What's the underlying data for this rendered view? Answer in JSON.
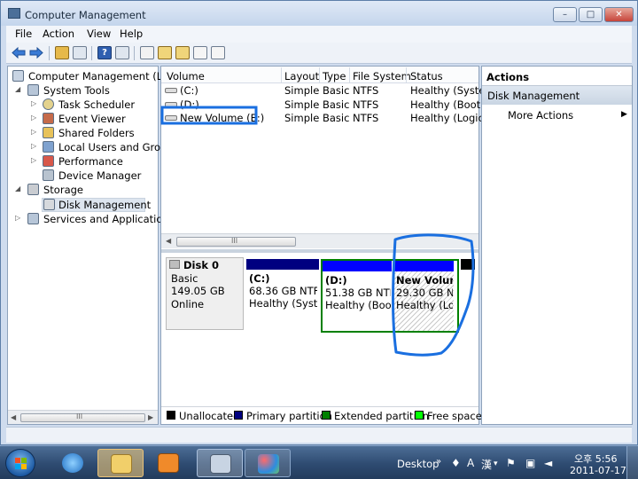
{
  "window": {
    "title": "Computer Management",
    "menu": [
      "File",
      "Action",
      "View",
      "Help"
    ]
  },
  "tree": {
    "root": "Computer Management (Local",
    "system_tools": "System Tools",
    "task_scheduler": "Task Scheduler",
    "event_viewer": "Event Viewer",
    "shared_folders": "Shared Folders",
    "local_users": "Local Users and Groups",
    "performance": "Performance",
    "device_manager": "Device Manager",
    "storage": "Storage",
    "disk_management": "Disk Management",
    "services": "Services and Applications",
    "scroll_grip": "III"
  },
  "volumes": {
    "columns": [
      "Volume",
      "Layout",
      "Type",
      "File System",
      "Status"
    ],
    "rows": [
      {
        "volume": "(C:)",
        "layout": "Simple",
        "type": "Basic",
        "fs": "NTFS",
        "status": "Healthy (System"
      },
      {
        "volume": "(D:)",
        "layout": "Simple",
        "type": "Basic",
        "fs": "NTFS",
        "status": "Healthy (Boot, P"
      },
      {
        "volume": "New Volume (E:)",
        "layout": "Simple",
        "type": "Basic",
        "fs": "NTFS",
        "status": "Healthy (Logica"
      }
    ],
    "scroll_grip": "III"
  },
  "disk": {
    "name": "Disk 0",
    "type": "Basic",
    "size": "149.05 GB",
    "state": "Online",
    "partitions": [
      {
        "name": "(C:)",
        "size": "68.36 GB NTFS",
        "status": "Healthy (Syste"
      },
      {
        "name": "(D:)",
        "size": "51.38 GB NTF",
        "status": "Healthy (Boo"
      },
      {
        "name": "New Volum",
        "size": "29.30 GB NT",
        "status": "Healthy (Log"
      }
    ]
  },
  "legend": {
    "items": [
      {
        "label": "Unallocated",
        "color": "#000000"
      },
      {
        "label": "Primary partition",
        "color": "#000080"
      },
      {
        "label": "Extended partition",
        "color": "#008000"
      },
      {
        "label": "Free space",
        "color": "#00ff00"
      }
    ]
  },
  "actions": {
    "title": "Actions",
    "section": "Disk Management",
    "more": "More Actions"
  },
  "taskbar": {
    "desktop": "Desktop",
    "ime_a": "A",
    "ime_han": "漢",
    "time": "오후 5:56",
    "date": "2011-07-17"
  },
  "colors": {
    "primary_bar": "#0000ff",
    "extended_border": "#008000",
    "annotation": "#1a6fe0"
  }
}
